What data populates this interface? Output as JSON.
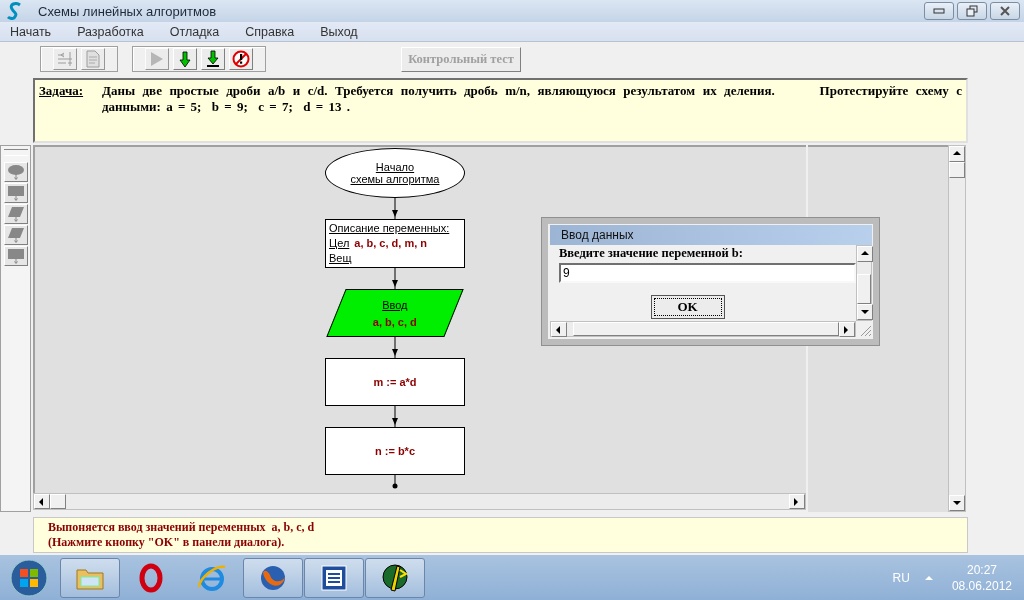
{
  "window": {
    "title": "Схемы линейных алгоритмов"
  },
  "menu": [
    "Начать",
    "Разработка",
    "Отладка",
    "Справка",
    "Выход"
  ],
  "toolbar": {
    "groups": [
      [
        {
          "kind": "align",
          "disabled": true
        },
        {
          "kind": "document",
          "disabled": true
        }
      ],
      [
        {
          "kind": "run",
          "disabled": true
        },
        {
          "kind": "step",
          "disabled": false
        },
        {
          "kind": "step_into",
          "disabled": false
        },
        {
          "kind": "stop",
          "disabled": false
        }
      ]
    ],
    "test_button": {
      "label": "Контрольный тест",
      "disabled": true
    }
  },
  "task": {
    "label": "Задача:",
    "text": "Даны две простые дроби a/b и c/d. Требуется получить дробь m/n, являющуюся результатом их деления.      Протестируйте схему с данными: a = 5;  b = 9;  c = 7;  d = 13 ."
  },
  "palette": [
    {
      "kind": "terminal"
    },
    {
      "kind": "process"
    },
    {
      "kind": "io"
    },
    {
      "kind": "io"
    },
    {
      "kind": "process"
    }
  ],
  "flowchart": {
    "nodes": [
      {
        "kind": "terminal",
        "lines": [
          "Начало",
          "схемы алгоритма"
        ],
        "active": false
      },
      {
        "kind": "declaration",
        "title": "Описание переменных:",
        "rows": [
          {
            "type": "Цел",
            "vars": "a, b, c, d, m, n"
          },
          {
            "type": "Вещ"
          }
        ],
        "active": false
      },
      {
        "kind": "io",
        "title": "Ввод",
        "vars": "a, b, c, d",
        "active": true
      },
      {
        "kind": "process",
        "text": "m := a*d",
        "active": false
      },
      {
        "kind": "process",
        "text": "n := b*c",
        "active": false
      }
    ]
  },
  "dialog": {
    "title": "Ввод данных",
    "prompt": "Введите значение переменной b:",
    "value": "9",
    "ok": "OK"
  },
  "status": [
    "Выпоняется ввод значений переменных  a, b, c, d",
    "(Нажмите кнопку \"OK\" в панели диалога)."
  ],
  "taskbar": {
    "apps": [
      {
        "kind": "folder",
        "running": true
      },
      {
        "kind": "ring",
        "running": false
      },
      {
        "kind": "globe",
        "running": false
      },
      {
        "kind": "fox",
        "running": true
      },
      {
        "kind": "document",
        "running": true
      },
      {
        "kind": "pencil",
        "running": true
      }
    ],
    "language": "RU",
    "time": "20:27",
    "date": "08.06.2012"
  }
}
